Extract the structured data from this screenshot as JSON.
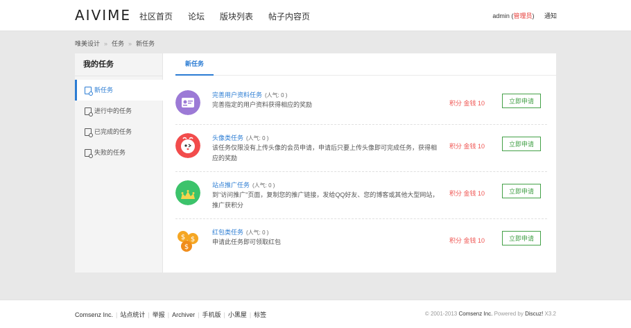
{
  "header": {
    "logo": "AIVIME",
    "nav": [
      "社区首页",
      "论坛",
      "版块列表",
      "帖子内容页"
    ],
    "username": "admin",
    "role_open": "(",
    "role": "管理员",
    "role_close": ")",
    "notice": "通知"
  },
  "breadcrumb": [
    "唯美设计",
    "任务",
    "新任务"
  ],
  "sidebar": {
    "title": "我的任务",
    "items": [
      {
        "label": "新任务"
      },
      {
        "label": "进行中的任务"
      },
      {
        "label": "已完成的任务"
      },
      {
        "label": "失败的任务"
      }
    ]
  },
  "tabs": {
    "active": "新任务"
  },
  "tasks": [
    {
      "name": "完善用户资料任务",
      "pop": "(人气: 0 )",
      "desc": "完善指定的用户资料获得相应的奖励",
      "reward": "积分 金钱 10",
      "apply": "立即申请",
      "color": "#9c7ad6"
    },
    {
      "name": "头像类任务",
      "pop": "(人气: 0 )",
      "desc": "该任务仅限没有上传头像的会员申请，申请后只要上传头像即可完成任务，获得相应的奖励",
      "reward": "积分 金钱 10",
      "apply": "立即申请",
      "color": "#f24c4c"
    },
    {
      "name": "站点推广任务",
      "pop": "(人气: 0 )",
      "desc": "到\"访问推广\"页面，复制您的推广链接，发给QQ好友、您的博客或其他大型网站，推广获积分",
      "reward": "积分 金钱 10",
      "apply": "立即申请",
      "color": "#3cc36b"
    },
    {
      "name": "红包类任务",
      "pop": "(人气: 0 )",
      "desc": "申请此任务即可领取红包",
      "reward": "积分 金钱 10",
      "apply": "立即申请",
      "color": "#f5a623"
    }
  ],
  "footer": {
    "links": [
      "Comsenz Inc.",
      "站点统计",
      "举报",
      "Archiver",
      "手机版",
      "小黑屋",
      "标签"
    ],
    "copy_pre": "© 2001-2013 ",
    "company": "Comsenz Inc.",
    "powered": " Powered by ",
    "product": "Discuz!",
    "version": " X3.2"
  }
}
